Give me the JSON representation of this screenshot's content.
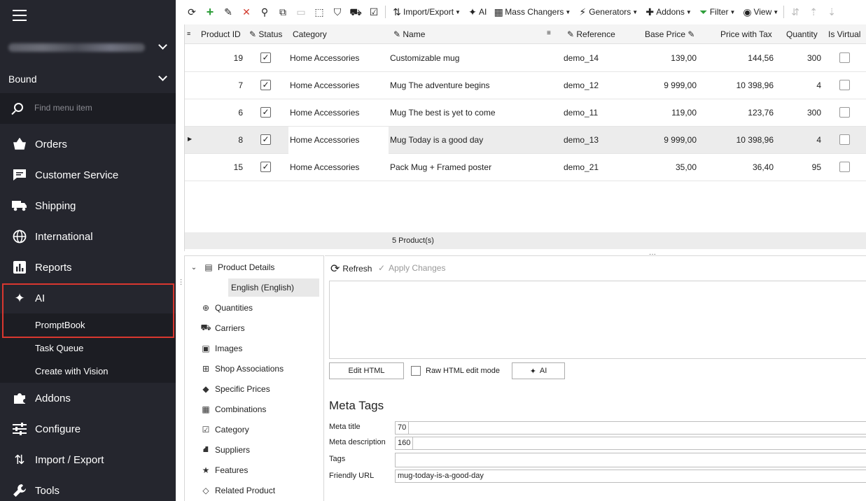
{
  "sidebar": {
    "store_label": "",
    "bound_label": "Bound",
    "search_placeholder": "Find menu item",
    "nav": [
      {
        "label": "Orders",
        "icon": "basket-icon"
      },
      {
        "label": "Customer Service",
        "icon": "chat-icon"
      },
      {
        "label": "Shipping",
        "icon": "truck-icon"
      },
      {
        "label": "International",
        "icon": "globe-icon"
      },
      {
        "label": "Reports",
        "icon": "chart-icon"
      },
      {
        "label": "AI",
        "icon": "sparkle-icon"
      }
    ],
    "ai_sub": [
      "PromptBook",
      "Task Queue",
      "Create with Vision"
    ],
    "nav2": [
      {
        "label": "Addons",
        "icon": "puzzle-icon"
      },
      {
        "label": "Configure",
        "icon": "sliders-icon"
      },
      {
        "label": "Import / Export",
        "icon": "arrows-icon"
      },
      {
        "label": "Tools",
        "icon": "wrench-icon"
      }
    ],
    "highlight_color": "#d9372f"
  },
  "toolbar": {
    "import_export": "Import/Export",
    "ai": "AI",
    "mass_changers": "Mass Changers",
    "generators": "Generators",
    "addons": "Addons",
    "filter": "Filter",
    "view": "View"
  },
  "grid": {
    "columns": [
      "Product ID",
      "Status",
      "Category",
      "Name",
      "Reference",
      "Base Price",
      "Price with Tax",
      "Quantity",
      "Is Virtual"
    ],
    "rows": [
      {
        "id": "19",
        "status": true,
        "category": "Home Accessories",
        "name": "Customizable mug",
        "reference": "demo_14",
        "base_price": "139,00",
        "price_tax": "144,56",
        "quantity": "300",
        "virtual": false
      },
      {
        "id": "7",
        "status": true,
        "category": "Home Accessories",
        "name": "Mug The adventure begins",
        "reference": "demo_12",
        "base_price": "9 999,00",
        "price_tax": "10 398,96",
        "quantity": "4",
        "virtual": false
      },
      {
        "id": "6",
        "status": true,
        "category": "Home Accessories",
        "name": "Mug The best is yet to come",
        "reference": "demo_11",
        "base_price": "119,00",
        "price_tax": "123,76",
        "quantity": "300",
        "virtual": false
      },
      {
        "id": "8",
        "status": true,
        "category": "Home Accessories",
        "name": "Mug Today is a good day",
        "reference": "demo_13",
        "base_price": "9 999,00",
        "price_tax": "10 398,96",
        "quantity": "4",
        "virtual": false
      },
      {
        "id": "15",
        "status": true,
        "category": "Home Accessories",
        "name": "Pack Mug + Framed poster",
        "reference": "demo_21",
        "base_price": "35,00",
        "price_tax": "36,40",
        "quantity": "95",
        "virtual": false
      }
    ],
    "footer": "5 Product(s)"
  },
  "tree": {
    "root": "Product Details",
    "sub": "English (English)",
    "items": [
      {
        "label": "Quantities",
        "icon": "quantity-icon"
      },
      {
        "label": "Carriers",
        "icon": "truck-icon"
      },
      {
        "label": "Images",
        "icon": "image-icon"
      },
      {
        "label": "Shop Associations",
        "icon": "shop-icon"
      },
      {
        "label": "Specific Prices",
        "icon": "tag-icon"
      },
      {
        "label": "Combinations",
        "icon": "grid-icon"
      },
      {
        "label": "Category",
        "icon": "category-icon"
      },
      {
        "label": "Suppliers",
        "icon": "supplier-icon"
      },
      {
        "label": "Features",
        "icon": "star-icon"
      },
      {
        "label": "Related Product",
        "icon": "diamond-icon"
      }
    ]
  },
  "detail": {
    "refresh": "Refresh",
    "apply": "Apply Changes",
    "edit_html": "Edit HTML",
    "raw_mode": "Raw HTML edit mode",
    "ai": "AI",
    "meta_heading": "Meta Tags",
    "meta_title_label": "Meta title",
    "meta_title_count": "70",
    "meta_desc_label": "Meta description",
    "meta_desc_count": "160",
    "tags_label": "Tags",
    "url_label": "Friendly URL",
    "url_value": "mug-today-is-a-good-day"
  }
}
